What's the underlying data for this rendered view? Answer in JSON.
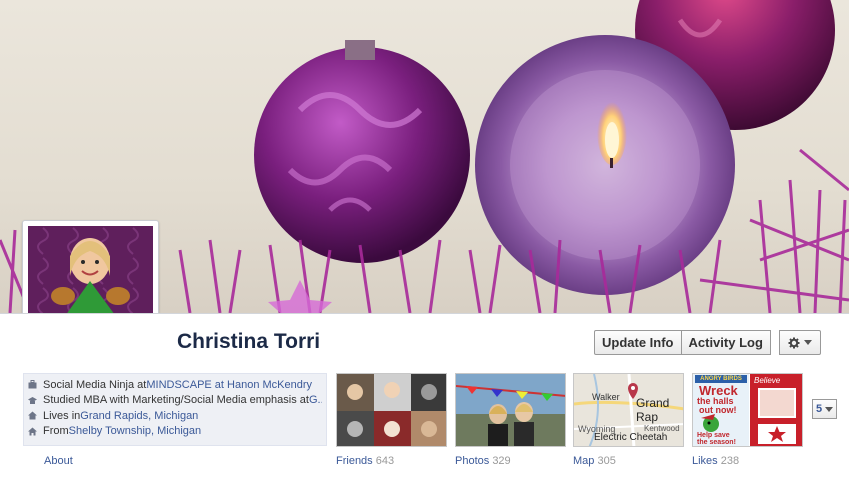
{
  "profile": {
    "name": "Christina Torri"
  },
  "actions": {
    "update_info": "Update Info",
    "activity_log": "Activity Log",
    "settings_icon": "gear-icon"
  },
  "about": {
    "lines": [
      {
        "icon": "briefcase-icon",
        "prefix": "Social Media Ninja at ",
        "link": "MINDSCAPE at Hanon McKendry"
      },
      {
        "icon": "graduation-icon",
        "prefix": "Studied MBA with Marketing/Social Media emphasis at ",
        "link": "G..."
      },
      {
        "icon": "home-icon",
        "prefix": "Lives in ",
        "link": "Grand Rapids, Michigan"
      },
      {
        "icon": "house-icon",
        "prefix": "From ",
        "link": "Shelby Township, Michigan"
      }
    ],
    "label": "About"
  },
  "tiles": [
    {
      "label": "Friends",
      "count": "643"
    },
    {
      "label": "Photos",
      "count": "329"
    },
    {
      "label": "Map",
      "count": "305"
    },
    {
      "label": "Likes",
      "count": "238"
    }
  ],
  "map": {
    "places": [
      "Walker",
      "Grand Rap",
      "Wyoming",
      "Kentwood",
      "Electric Cheetah"
    ]
  },
  "likes_tile": {
    "game_title": "ANGRY BIRDS",
    "headline_1": "Wreck",
    "headline_2": "the halls",
    "headline_3": "out now!",
    "footer_1": "Help save",
    "footer_2": "the season!",
    "side_label": "Believe"
  },
  "more": {
    "label": "5"
  },
  "colors": {
    "link": "#3b5998",
    "name": "#1c2a47",
    "about_bg": "#eef0f5"
  }
}
